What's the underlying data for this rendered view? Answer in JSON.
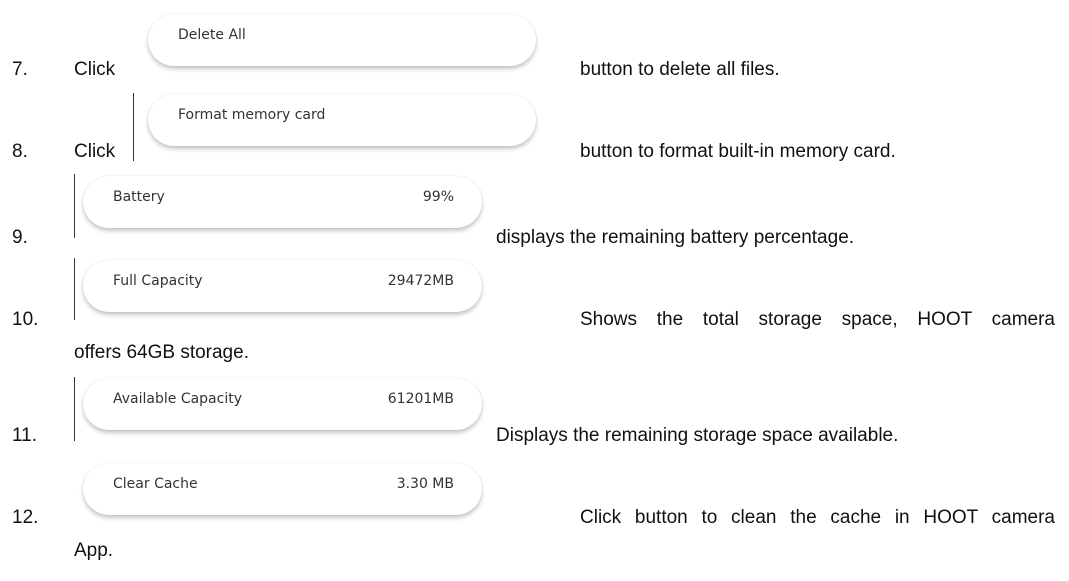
{
  "items": [
    {
      "number": "7.",
      "click": "Click",
      "button_label": "Delete All",
      "text": "button to delete all files."
    },
    {
      "number": "8.",
      "click": "Click",
      "button_label": "Format memory card",
      "text": "button to format built-in memory card."
    },
    {
      "number": "9.",
      "label": "Battery",
      "value": "99%",
      "text": "displays the remaining battery percentage."
    },
    {
      "number": "10.",
      "label": "Full Capacity",
      "value": "29472MB",
      "text": "Shows the total storage space, HOOT camera",
      "continuation": "offers 64GB storage."
    },
    {
      "number": "11.",
      "label": "Available Capacity",
      "value": "61201MB",
      "text": "Displays the remaining storage space available."
    },
    {
      "number": "12.",
      "label": "Clear Cache",
      "value": "3.30 MB",
      "text": "Click button to clean the cache in HOOT camera",
      "continuation": "App."
    }
  ]
}
